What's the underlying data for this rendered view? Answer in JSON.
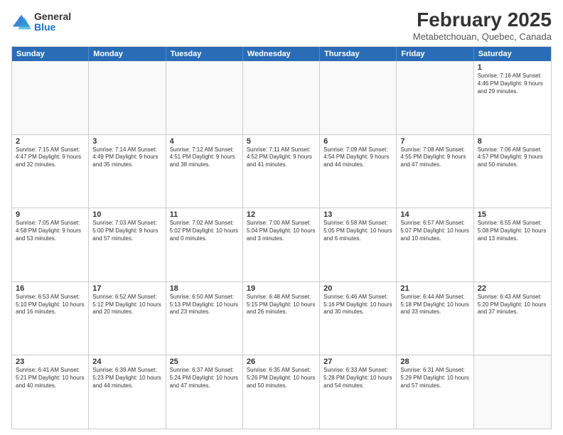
{
  "header": {
    "logo_general": "General",
    "logo_blue": "Blue",
    "month_year": "February 2025",
    "location": "Metabetchouan, Quebec, Canada"
  },
  "days_of_week": [
    "Sunday",
    "Monday",
    "Tuesday",
    "Wednesday",
    "Thursday",
    "Friday",
    "Saturday"
  ],
  "weeks": [
    [
      {
        "day": "",
        "info": ""
      },
      {
        "day": "",
        "info": ""
      },
      {
        "day": "",
        "info": ""
      },
      {
        "day": "",
        "info": ""
      },
      {
        "day": "",
        "info": ""
      },
      {
        "day": "",
        "info": ""
      },
      {
        "day": "1",
        "info": "Sunrise: 7:16 AM\nSunset: 4:46 PM\nDaylight: 9 hours and 29 minutes."
      }
    ],
    [
      {
        "day": "2",
        "info": "Sunrise: 7:15 AM\nSunset: 4:47 PM\nDaylight: 9 hours and 32 minutes."
      },
      {
        "day": "3",
        "info": "Sunrise: 7:14 AM\nSunset: 4:49 PM\nDaylight: 9 hours and 35 minutes."
      },
      {
        "day": "4",
        "info": "Sunrise: 7:12 AM\nSunset: 4:51 PM\nDaylight: 9 hours and 38 minutes."
      },
      {
        "day": "5",
        "info": "Sunrise: 7:11 AM\nSunset: 4:52 PM\nDaylight: 9 hours and 41 minutes."
      },
      {
        "day": "6",
        "info": "Sunrise: 7:09 AM\nSunset: 4:54 PM\nDaylight: 9 hours and 44 minutes."
      },
      {
        "day": "7",
        "info": "Sunrise: 7:08 AM\nSunset: 4:55 PM\nDaylight: 9 hours and 47 minutes."
      },
      {
        "day": "8",
        "info": "Sunrise: 7:06 AM\nSunset: 4:57 PM\nDaylight: 9 hours and 50 minutes."
      }
    ],
    [
      {
        "day": "9",
        "info": "Sunrise: 7:05 AM\nSunset: 4:58 PM\nDaylight: 9 hours and 53 minutes."
      },
      {
        "day": "10",
        "info": "Sunrise: 7:03 AM\nSunset: 5:00 PM\nDaylight: 9 hours and 57 minutes."
      },
      {
        "day": "11",
        "info": "Sunrise: 7:02 AM\nSunset: 5:02 PM\nDaylight: 10 hours and 0 minutes."
      },
      {
        "day": "12",
        "info": "Sunrise: 7:00 AM\nSunset: 5:04 PM\nDaylight: 10 hours and 3 minutes."
      },
      {
        "day": "13",
        "info": "Sunrise: 6:58 AM\nSunset: 5:05 PM\nDaylight: 10 hours and 6 minutes."
      },
      {
        "day": "14",
        "info": "Sunrise: 6:57 AM\nSunset: 5:07 PM\nDaylight: 10 hours and 10 minutes."
      },
      {
        "day": "15",
        "info": "Sunrise: 6:55 AM\nSunset: 5:08 PM\nDaylight: 10 hours and 13 minutes."
      }
    ],
    [
      {
        "day": "16",
        "info": "Sunrise: 6:53 AM\nSunset: 5:10 PM\nDaylight: 10 hours and 16 minutes."
      },
      {
        "day": "17",
        "info": "Sunrise: 6:52 AM\nSunset: 5:12 PM\nDaylight: 10 hours and 20 minutes."
      },
      {
        "day": "18",
        "info": "Sunrise: 6:50 AM\nSunset: 5:13 PM\nDaylight: 10 hours and 23 minutes."
      },
      {
        "day": "19",
        "info": "Sunrise: 6:48 AM\nSunset: 5:15 PM\nDaylight: 10 hours and 26 minutes."
      },
      {
        "day": "20",
        "info": "Sunrise: 6:46 AM\nSunset: 5:16 PM\nDaylight: 10 hours and 30 minutes."
      },
      {
        "day": "21",
        "info": "Sunrise: 6:44 AM\nSunset: 5:18 PM\nDaylight: 10 hours and 33 minutes."
      },
      {
        "day": "22",
        "info": "Sunrise: 6:43 AM\nSunset: 5:20 PM\nDaylight: 10 hours and 37 minutes."
      }
    ],
    [
      {
        "day": "23",
        "info": "Sunrise: 6:41 AM\nSunset: 5:21 PM\nDaylight: 10 hours and 40 minutes."
      },
      {
        "day": "24",
        "info": "Sunrise: 6:39 AM\nSunset: 5:23 PM\nDaylight: 10 hours and 44 minutes."
      },
      {
        "day": "25",
        "info": "Sunrise: 6:37 AM\nSunset: 5:24 PM\nDaylight: 10 hours and 47 minutes."
      },
      {
        "day": "26",
        "info": "Sunrise: 6:35 AM\nSunset: 5:26 PM\nDaylight: 10 hours and 50 minutes."
      },
      {
        "day": "27",
        "info": "Sunrise: 6:33 AM\nSunset: 5:28 PM\nDaylight: 10 hours and 54 minutes."
      },
      {
        "day": "28",
        "info": "Sunrise: 6:31 AM\nSunset: 5:29 PM\nDaylight: 10 hours and 57 minutes."
      },
      {
        "day": "",
        "info": ""
      }
    ]
  ]
}
